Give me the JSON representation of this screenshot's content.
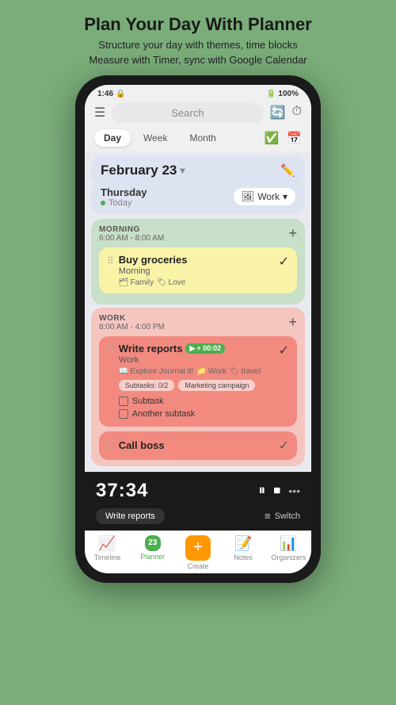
{
  "header": {
    "title": "Plan Your Day With Planner",
    "subtitle_line1": "Structure your day with themes, time blocks",
    "subtitle_line2": "Measure with Timer, sync with Google Calendar"
  },
  "statusBar": {
    "time": "1:46",
    "battery": "100%"
  },
  "topBar": {
    "search_placeholder": "Search"
  },
  "periodTabs": {
    "tabs": [
      "Day",
      "Week",
      "Month"
    ],
    "active": "Day"
  },
  "dateHeader": {
    "date": "February 23",
    "day_name": "Thursday",
    "today_label": "Today",
    "work_tag": "Work"
  },
  "sections": [
    {
      "id": "morning",
      "title": "MORNING",
      "time": "6:00 AM - 8:00 AM",
      "type": "morning",
      "tasks": [
        {
          "id": "task1",
          "title": "Buy groceries",
          "subtitle": "Morning",
          "tags": [
            "Family",
            "Love"
          ],
          "checked": true
        }
      ]
    },
    {
      "id": "work",
      "title": "WORK",
      "time": "8:00 AM - 4:00 PM",
      "type": "work",
      "tasks": [
        {
          "id": "task2",
          "title": "Write reports",
          "subtitle": "Work",
          "timer_badge": "+ 00:02",
          "tags": [
            "Explore Journal it!",
            "Work",
            "travel"
          ],
          "subtask_chips": [
            "Subtasks: 0/2",
            "Marketing campaign"
          ],
          "subtasks": [
            "Subtask",
            "Another subtask"
          ],
          "checked": true
        },
        {
          "id": "task3",
          "title": "Call boss",
          "checked": false
        }
      ]
    }
  ],
  "timerBar": {
    "display": "37:34",
    "task_label": "Write reports",
    "switch_label": "Switch"
  },
  "bottomNav": {
    "items": [
      {
        "icon": "📈",
        "label": "Timeline",
        "active": false
      },
      {
        "icon": "📅",
        "label": "Planner",
        "active": true,
        "badge": "23"
      },
      {
        "icon": "+",
        "label": "Create",
        "active": false,
        "isCreate": true
      },
      {
        "icon": "📝",
        "label": "Notes",
        "active": false
      },
      {
        "icon": "📊",
        "label": "Organizers",
        "active": false
      }
    ]
  }
}
